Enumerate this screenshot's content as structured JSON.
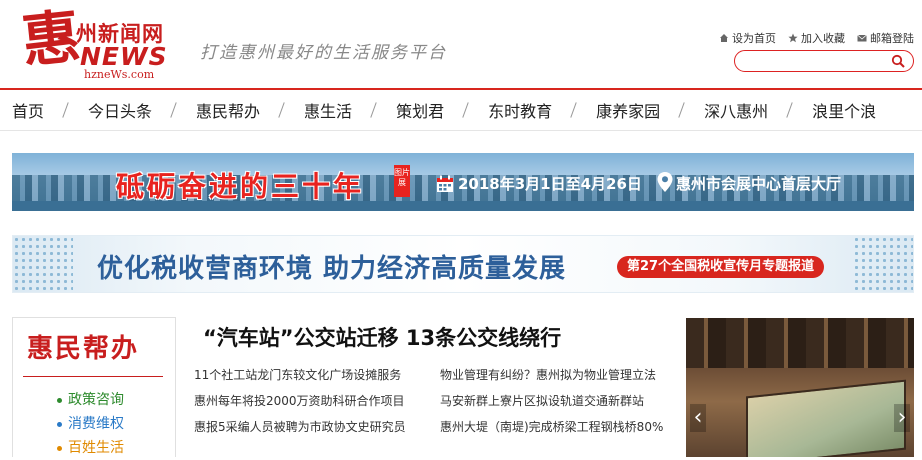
{
  "header": {
    "logo": {
      "char": "惠",
      "cn": "州新闻网",
      "en": "NEWS",
      "domain": "hzneWs.com"
    },
    "slogan": "打造惠州最好的生活服务平台",
    "links": [
      {
        "label": "设为首页",
        "icon": "home-icon"
      },
      {
        "label": "加入收藏",
        "icon": "star-icon"
      },
      {
        "label": "邮箱登陆",
        "icon": "mail-icon"
      }
    ],
    "search": {
      "placeholder": "",
      "icon": "search-icon"
    }
  },
  "nav": {
    "items": [
      "首页",
      "今日头条",
      "惠民帮办",
      "惠生活",
      "策划君",
      "东时教育",
      "康养家园",
      "深八惠州",
      "浪里个浪"
    ]
  },
  "banner1": {
    "title": "砥砺奋进的三十年",
    "tag": "图片展",
    "date": "2018年3月1日至4月26日",
    "venue": "惠州市会展中心首层大厅"
  },
  "banner2": {
    "title": "优化税收营商环境 助力经济高质量发展",
    "pill": "第27个全国税收宣传月专题报道"
  },
  "sidebox": {
    "title": "惠民帮办",
    "items": [
      {
        "label": "政策咨询",
        "color": "#2e8b2e"
      },
      {
        "label": "消费维权",
        "color": "#2a7ac7"
      },
      {
        "label": "百姓生活",
        "color": "#e08a00"
      }
    ]
  },
  "main": {
    "headline": "“汽车站”公交站迁移 13条公交线绕行",
    "news_left": [
      "11个社工站龙门东较文化广场设摊服务",
      "惠州每年将投2000万资助科研合作项目",
      "惠报5采编人员被聘为市政协文史研究员"
    ],
    "news_right": [
      "物业管理有纠纷？惠州拟为物业管理立法",
      "马安新群上寮片区拟设轨道交通新群站",
      "惠州大堤（南堤)完成桥梁工程钢栈桥80%"
    ]
  },
  "colors": {
    "brand": "#d8261e",
    "banner2_text": "#2d5f9a"
  }
}
